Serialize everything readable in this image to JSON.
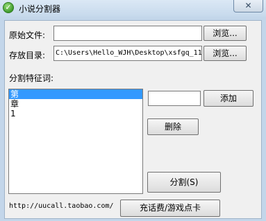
{
  "window": {
    "title": "小说分割器",
    "close_glyph": "✕"
  },
  "labels": {
    "source_file": "原始文件:",
    "save_dir": "存放目录:",
    "split_keyword": "分割特征词:"
  },
  "fields": {
    "source_file_value": "",
    "save_dir_value": "C:\\Users\\Hello_WJH\\Desktop\\xsfgq_11",
    "keyword_input_value": ""
  },
  "buttons": {
    "browse_source": "浏览...",
    "browse_save": "浏览...",
    "add": "添加",
    "delete": "删除",
    "split": "分割(S)",
    "recharge": "充话费/游戏点卡"
  },
  "keyword_list": [
    {
      "text": "第",
      "selected": true
    },
    {
      "text": "章",
      "selected": false
    },
    {
      "text": "1",
      "selected": false
    }
  ],
  "footer": {
    "url": "http://uucall.taobao.com/"
  }
}
